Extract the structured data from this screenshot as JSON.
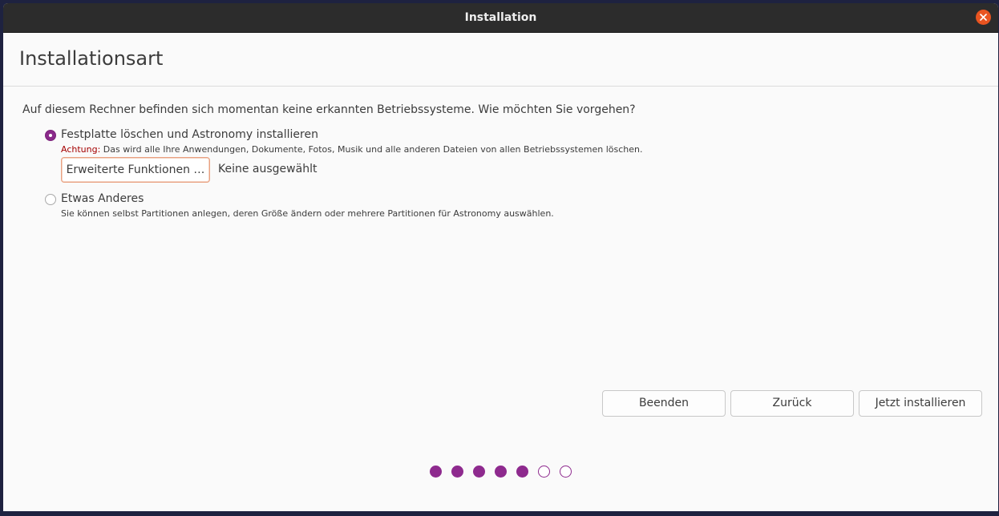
{
  "window": {
    "title": "Installation",
    "close_icon": "close-icon"
  },
  "page": {
    "title": "Installationsart",
    "question": "Auf diesem Rechner befinden sich momentan keine erkannten Betriebssysteme. Wie möchten Sie vorgehen?"
  },
  "options": [
    {
      "label": "Festplatte löschen und Astronomy installieren",
      "selected": true,
      "warning_prefix": "Achtung:",
      "description": " Das wird alle Ihre Anwendungen, Dokumente, Fotos, Musik und alle anderen Dateien von allen Betriebssystemen löschen.",
      "advanced_button": "Erweiterte Funktionen …",
      "advanced_status": "Keine ausgewählt"
    },
    {
      "label": "Etwas Anderes",
      "selected": false,
      "description": "Sie können selbst Partitionen anlegen, deren Größe ändern oder mehrere Partitionen für Astronomy auswählen."
    }
  ],
  "buttons": {
    "quit": "Beenden",
    "back": "Zurück",
    "install": "Jetzt installieren"
  },
  "progress": {
    "total_steps": 7,
    "completed_steps": 5
  },
  "colors": {
    "accent": "#8e2a8e",
    "close": "#e95420",
    "warning": "#a40000"
  }
}
